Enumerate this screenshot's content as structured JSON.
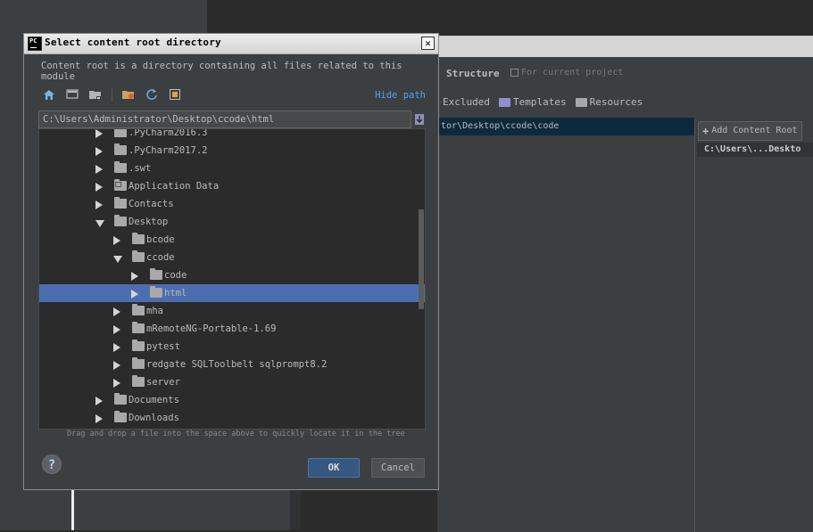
{
  "background": {
    "structure_label": "Structure",
    "for_current_project": "For current project",
    "tabs": [
      "Excluded",
      "Templates",
      "Resources"
    ],
    "content_path": "tor\\Desktop\\ccode\\code",
    "add_content_root": "Add Content Root",
    "root_path": "C:\\Users\\...Deskto"
  },
  "dialog": {
    "app_icon_text": "PC",
    "title": "Select content root directory",
    "close_symbol": "✕",
    "description": "Content root is a directory containing all files related to this module",
    "hide_path": "Hide path",
    "path_value": "C:\\Users\\Administrator\\Desktop\\ccode\\html",
    "hint": "Drag and drop a file into the space above to quickly locate it in the tree",
    "help_symbol": "?",
    "ok_label": "OK",
    "cancel_label": "Cancel"
  },
  "tree": [
    {
      "label": ".PyCharm2016.3",
      "depth": 0,
      "expanded": false,
      "selected": false,
      "link": false
    },
    {
      "label": ".PyCharm2017.2",
      "depth": 0,
      "expanded": false,
      "selected": false,
      "link": false
    },
    {
      "label": ".swt",
      "depth": 0,
      "expanded": false,
      "selected": false,
      "link": false
    },
    {
      "label": "Application Data",
      "depth": 0,
      "expanded": false,
      "selected": false,
      "link": true
    },
    {
      "label": "Contacts",
      "depth": 0,
      "expanded": false,
      "selected": false,
      "link": false
    },
    {
      "label": "Desktop",
      "depth": 0,
      "expanded": true,
      "selected": false,
      "link": false
    },
    {
      "label": "bcode",
      "depth": 1,
      "expanded": false,
      "selected": false,
      "link": false
    },
    {
      "label": "ccode",
      "depth": 1,
      "expanded": true,
      "selected": false,
      "link": false
    },
    {
      "label": "code",
      "depth": 2,
      "expanded": false,
      "selected": false,
      "link": false
    },
    {
      "label": "html",
      "depth": 2,
      "expanded": false,
      "selected": true,
      "link": false
    },
    {
      "label": "mha",
      "depth": 1,
      "expanded": false,
      "selected": false,
      "link": false
    },
    {
      "label": "mRemoteNG-Portable-1.69",
      "depth": 1,
      "expanded": false,
      "selected": false,
      "link": false
    },
    {
      "label": "pytest",
      "depth": 1,
      "expanded": false,
      "selected": false,
      "link": false
    },
    {
      "label": "redgate SQLToolbelt sqlprompt8.2",
      "depth": 1,
      "expanded": false,
      "selected": false,
      "link": false
    },
    {
      "label": "server",
      "depth": 1,
      "expanded": false,
      "selected": false,
      "link": false
    },
    {
      "label": "Documents",
      "depth": 0,
      "expanded": false,
      "selected": false,
      "link": false
    },
    {
      "label": "Downloads",
      "depth": 0,
      "expanded": false,
      "selected": false,
      "link": false
    }
  ],
  "colors": {
    "selection": "#4b6eaf",
    "link": "#589df6",
    "ok_button": "#365880"
  },
  "icons": [
    "home-icon",
    "desktop-icon",
    "project-folder-icon",
    "new-folder-icon",
    "refresh-icon",
    "show-hidden-icon",
    "download-path-icon"
  ]
}
